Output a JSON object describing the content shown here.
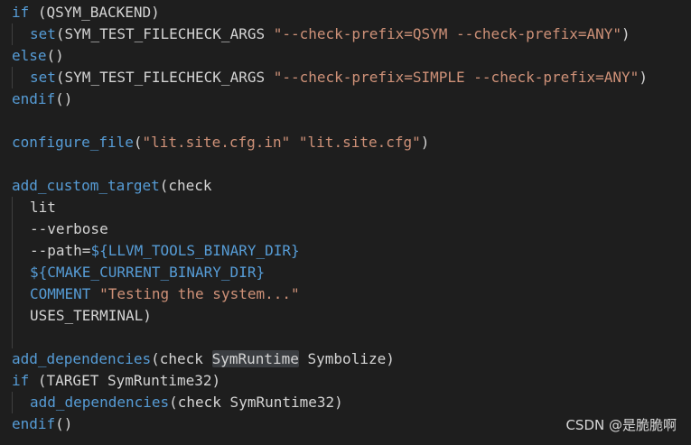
{
  "code": {
    "l1": {
      "kw": "if",
      "rest": " (QSYM_BACKEND)"
    },
    "l2": {
      "fn": "set",
      "mid": "(SYM_TEST_FILECHECK_ARGS ",
      "str": "\"--check-prefix=QSYM --check-prefix=ANY\"",
      "end": ")"
    },
    "l3": {
      "kw": "else",
      "rest": "()"
    },
    "l4": {
      "fn": "set",
      "mid": "(SYM_TEST_FILECHECK_ARGS ",
      "str": "\"--check-prefix=SIMPLE --check-prefix=ANY\"",
      "end": ")"
    },
    "l5": {
      "kw": "endif",
      "rest": "()"
    },
    "l7": {
      "fn": "configure_file",
      "open": "(",
      "str1": "\"lit.site.cfg.in\"",
      "sp": " ",
      "str2": "\"lit.site.cfg\"",
      "end": ")"
    },
    "l9": {
      "fn": "add_custom_target",
      "rest": "(check"
    },
    "l10": {
      "text": "lit"
    },
    "l11": {
      "text": "--verbose"
    },
    "l12": {
      "pre": "--path=",
      "var": "${LLVM_TOOLS_BINARY_DIR}"
    },
    "l13": {
      "var": "${CMAKE_CURRENT_BINARY_DIR}"
    },
    "l14": {
      "kw": "COMMENT",
      "sp": " ",
      "str": "\"Testing the system...\""
    },
    "l15": {
      "text": "USES_TERMINAL)"
    },
    "l17": {
      "fn": "add_dependencies",
      "pre": "(check ",
      "hl": "SymRuntime",
      "post": " Symbolize)"
    },
    "l18": {
      "kw": "if",
      "rest": " (TARGET SymRuntime32)"
    },
    "l19": {
      "fn": "add_dependencies",
      "rest": "(check SymRuntime32)"
    },
    "l20": {
      "kw": "endif",
      "rest": "()"
    }
  },
  "watermark": "CSDN @是脆脆啊"
}
